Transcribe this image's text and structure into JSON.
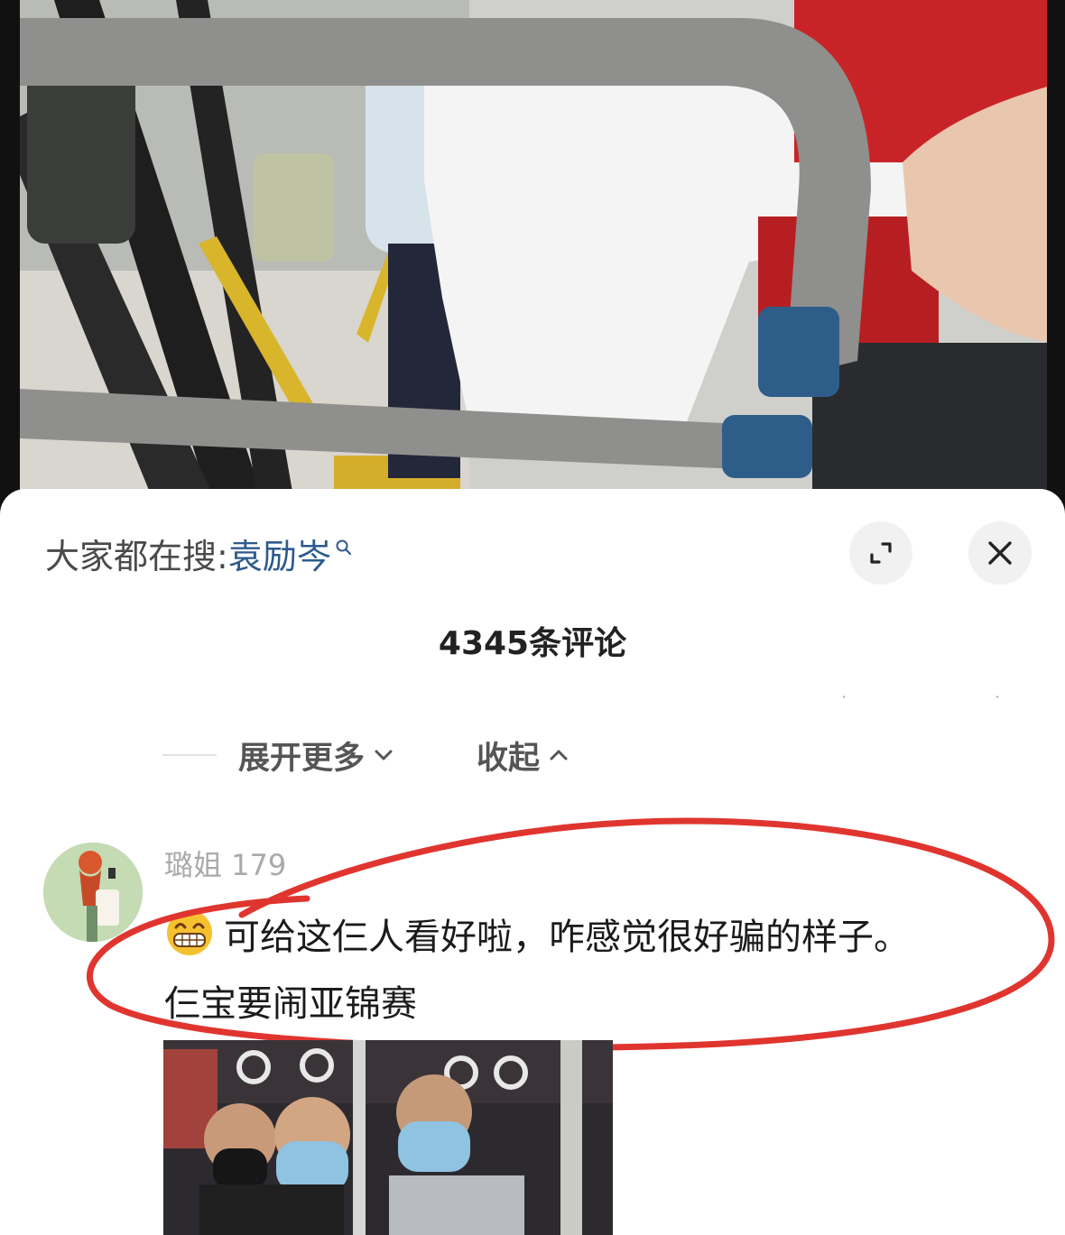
{
  "video": {
    "description_icon": "video-frame"
  },
  "search": {
    "prefix": "大家都在搜:",
    "term": "袁励岑",
    "icon": "search-icon"
  },
  "header": {
    "expand_icon": "expand-icon",
    "close_icon": "close-icon"
  },
  "comments": {
    "count_label": "4345条评论",
    "expand_more_label": "展开更多",
    "collapse_label": "收起"
  },
  "comment": {
    "username": "璐姐 179",
    "line1": "可给这仨人看好啦，咋感觉很好骗的样子。",
    "line2": "仨宝要闹亚锦赛",
    "emoji": "grinning-face-icon"
  },
  "colors": {
    "search_term": "#2d5a8e",
    "annotation_circle": "#e0352f"
  }
}
